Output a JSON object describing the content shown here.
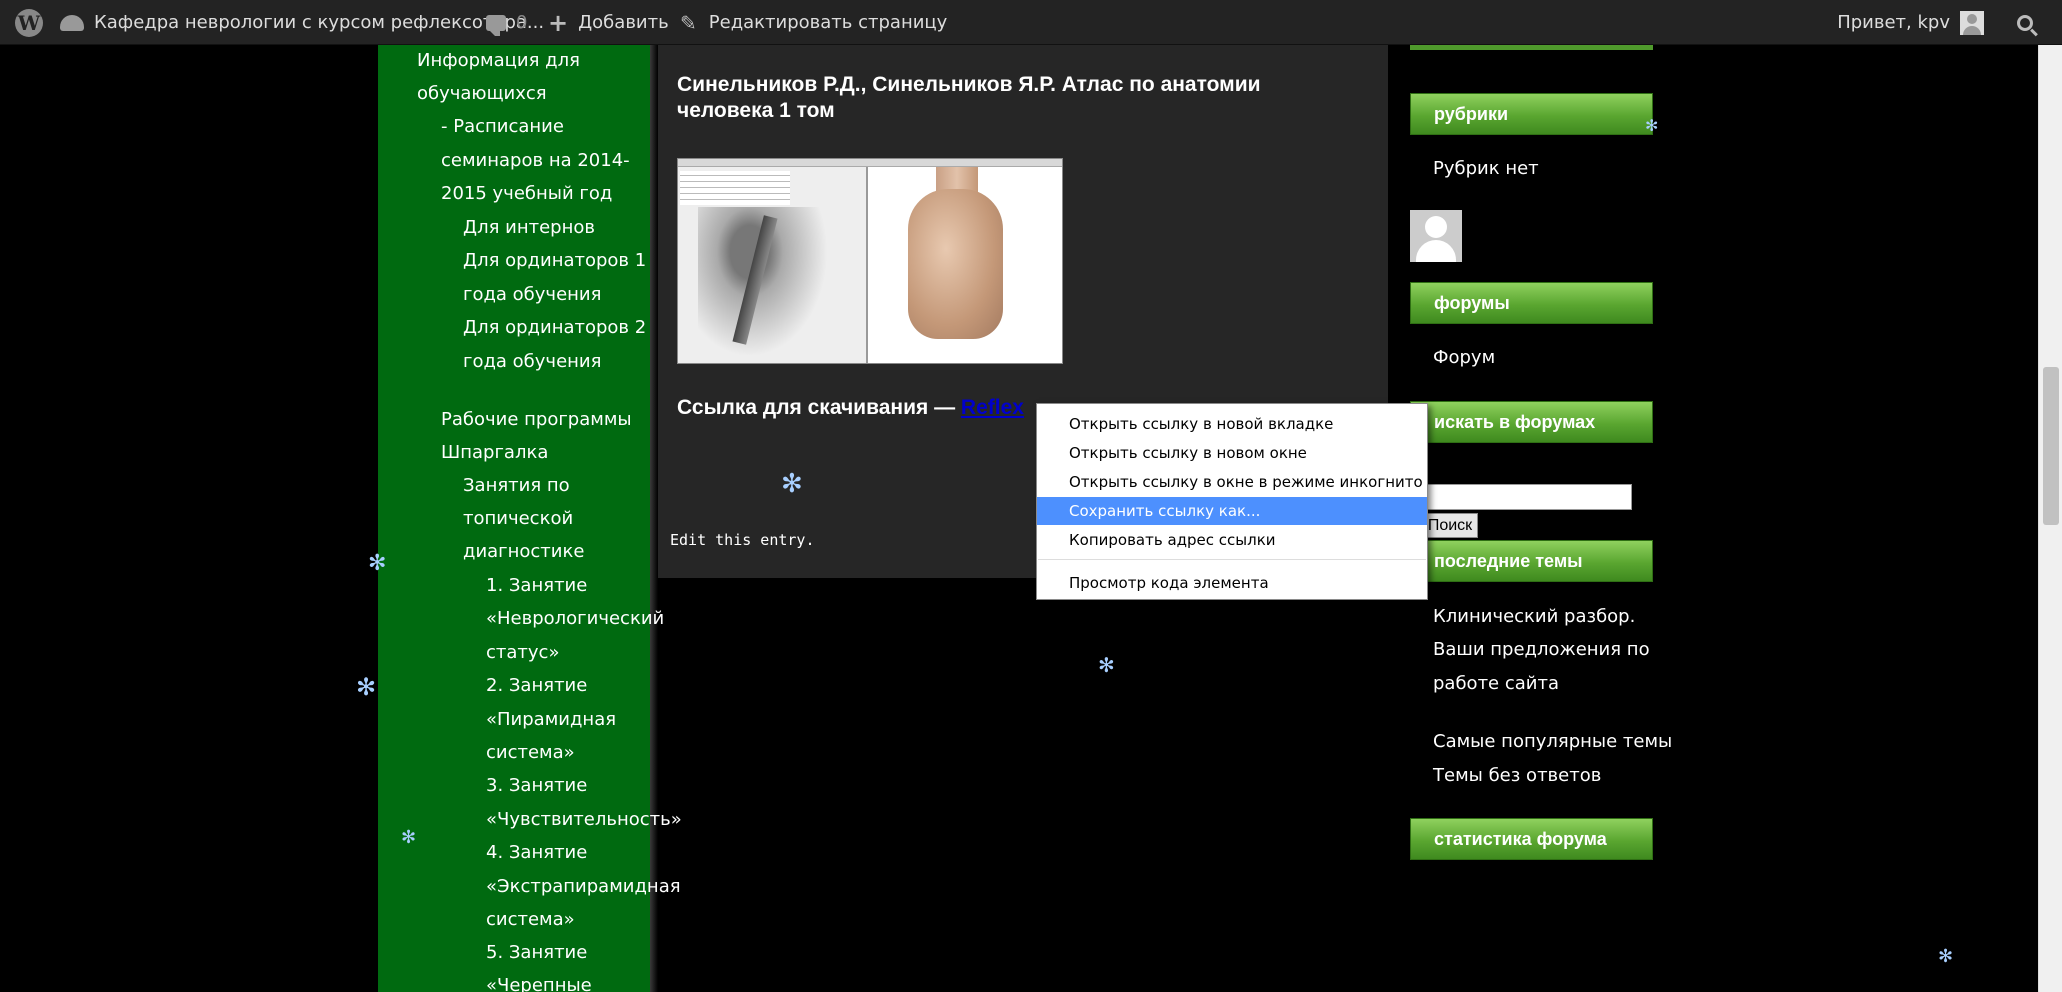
{
  "admin_bar": {
    "site_name": "Кафедра неврологии с курсом рефлексотера...",
    "comments_count": "0",
    "add_new": "Добавить",
    "edit_page": "Редактировать страницу",
    "greeting": "Привет, kpv"
  },
  "left_nav": {
    "lines": [
      "Информация для",
      "обучающихся",
      "- Расписание",
      "семинаров на 2014-",
      "2015 учебный год",
      "Для интернов",
      "Для ординаторов 1",
      "года обучения",
      "Для ординаторов 2",
      "года обучения",
      "Рабочие программы",
      "Шпаргалка",
      "Занятия по",
      "топической",
      "диагностике",
      "1. Занятие",
      "«Неврологический",
      "статус»",
      "2. Занятие",
      "«Пирамидная",
      "система»",
      "3. Занятие",
      "«Чувствительность»",
      "4. Занятие",
      "«Экстрапирамидная",
      "система»",
      "5. Занятие",
      "«Черепные"
    ]
  },
  "post": {
    "title": "Синельников Р.Д., Синельников Я.Р. Атлас по анатомии человека 1 том",
    "download_label": "Ссылка для скачивания — ",
    "download_link": "Reflex",
    "edit_entry": "Edit this entry."
  },
  "right_sidebar": {
    "rubrics_heading": "рубрики",
    "rubrics_text": "Рубрик нет",
    "forums_heading": "форумы",
    "forums_link": "Форум",
    "search_heading": "искать в форумах",
    "search_button": "Поиск",
    "latest_heading": "последние темы",
    "latest_topic_lines": [
      "Клинический разбор.",
      "Ваши предложения по",
      "работе сайта"
    ],
    "popular_topics": "Самые популярные темы",
    "unanswered_topics": "Темы без ответов",
    "stats_heading": "статистика форума"
  },
  "context_menu": {
    "items": [
      "Открыть ссылку в новой вкладке",
      "Открыть ссылку в новом окне",
      "Открыть ссылку в окне в режиме инкогнито",
      "Сохранить ссылку как...",
      "Копировать адрес ссылки",
      "Просмотр кода элемента"
    ],
    "highlighted_index": 3,
    "highlight_color": "#4d90fe"
  },
  "colors": {
    "nav_green": "#006a10",
    "heading_green": "#5aa630",
    "content_bg": "#262626",
    "admin_bar": "#232323"
  },
  "icons": [
    "wordpress-logo-icon",
    "dashboard-icon",
    "comment-bubble-icon",
    "plus-icon",
    "pencil-icon",
    "avatar-icon",
    "search-icon",
    "snowflake-icon"
  ]
}
